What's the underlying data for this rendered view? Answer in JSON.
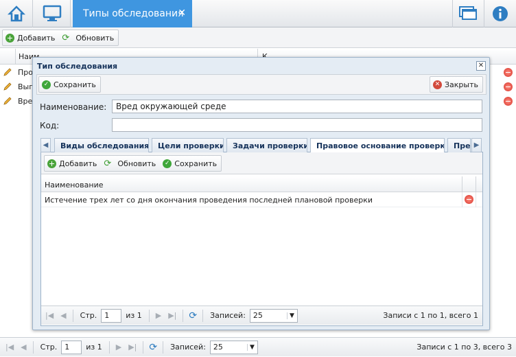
{
  "topbar": {
    "home_icon": "home-icon",
    "desktop_icon": "monitor-icon",
    "active_tab": "Типы обследования",
    "close_icon": "close-icon",
    "windows_icon": "windows-icon",
    "info_icon": "info-icon"
  },
  "main_toolbar": {
    "add": "Добавить",
    "refresh": "Обновить"
  },
  "main_grid": {
    "col_name": "Наим",
    "col_code": "К",
    "rows": [
      {
        "name": "Про"
      },
      {
        "name": "Вып"
      },
      {
        "name": "Вред"
      }
    ]
  },
  "main_pager": {
    "page_label": "Стр.",
    "page_value": "1",
    "of_pages": "из 1",
    "records_label": "Записей:",
    "records_value": "25",
    "status": "Записи с 1 по 3, всего 3"
  },
  "dialog": {
    "title": "Тип обследования",
    "save": "Сохранить",
    "close": "Закрыть",
    "name_label": "Наименование:",
    "name_value": "Вред окружающей среде",
    "code_label": "Код:",
    "code_value": "",
    "tabs": [
      {
        "label": "Виды обследования",
        "active": false
      },
      {
        "label": "Цели проверки",
        "active": false
      },
      {
        "label": "Задачи проверки",
        "active": false
      },
      {
        "label": "Правовое основание проверки",
        "active": true
      },
      {
        "label": "Пре",
        "active": false
      }
    ],
    "inner_toolbar": {
      "add": "Добавить",
      "refresh": "Обновить",
      "save": "Сохранить"
    },
    "grid": {
      "col_name": "Наименование",
      "rows": [
        {
          "name": "Истечение трех лет со дня окончания проведения последней плановой проверки"
        }
      ]
    },
    "pager": {
      "page_label": "Стр.",
      "page_value": "1",
      "of_pages": "из 1",
      "records_label": "Записей:",
      "records_value": "25",
      "status": "Записи с 1 по 1, всего 1"
    }
  },
  "colors": {
    "accent": "#3f96e0",
    "delete": "#d6342a",
    "add": "#4aa33a"
  }
}
